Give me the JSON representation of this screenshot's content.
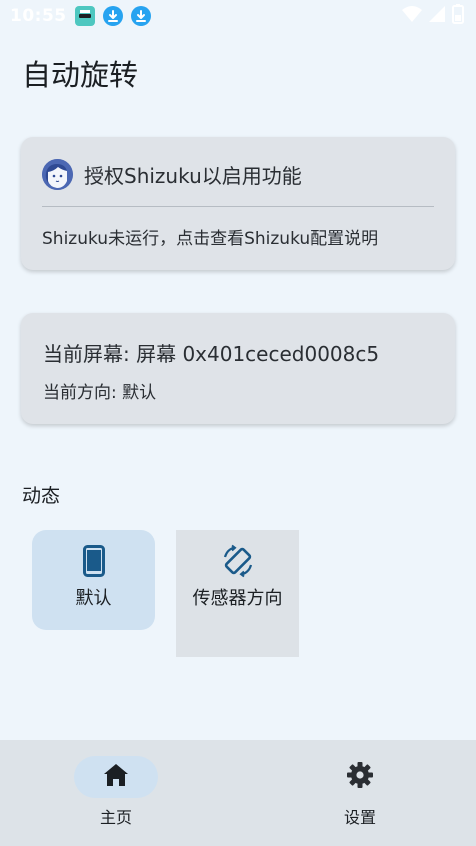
{
  "status_bar": {
    "time": "10:55",
    "icons": [
      "app-notification-icon",
      "download-icon",
      "download-icon",
      "wifi-icon",
      "cellular-icon",
      "battery-icon"
    ]
  },
  "app": {
    "title": "自动旋转"
  },
  "shizuku_card": {
    "title": "授权Shizuku以启用功能",
    "subtitle": "Shizuku未运行，点击查看Shizuku配置说明",
    "icon": "shizuku-avatar-icon"
  },
  "screen_card": {
    "screen_line": "当前屏幕: 屏幕 0x401ceced0008c5",
    "orientation_line": "当前方向: 默认"
  },
  "section": {
    "label": "动态"
  },
  "modes": [
    {
      "label": "默认",
      "icon": "phone-portrait-icon",
      "selected": true
    },
    {
      "label": "传感器方向",
      "icon": "screen-rotation-icon",
      "selected": false
    }
  ],
  "bottom_nav": [
    {
      "label": "主页",
      "icon": "home-icon",
      "selected": true
    },
    {
      "label": "设置",
      "icon": "gear-icon",
      "selected": false
    }
  ],
  "colors": {
    "background": "#eef5fb",
    "card": "#dfe3e8",
    "accent": "#1a5a8a",
    "selected_tile": "#cfe1f1",
    "nav_bar": "#dde3e8"
  }
}
